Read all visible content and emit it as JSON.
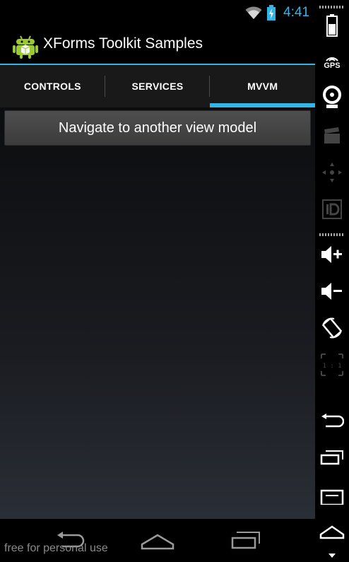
{
  "status_bar": {
    "time": "4:41",
    "icons": [
      "wifi-icon",
      "battery-charging-icon"
    ],
    "accent_color": "#33b5e5"
  },
  "action_bar": {
    "title": "XForms Toolkit Samples",
    "icon": "android-app-icon"
  },
  "tabs": [
    {
      "label": "CONTROLS",
      "selected": false
    },
    {
      "label": "SERVICES",
      "selected": false
    },
    {
      "label": "MVVM",
      "selected": true
    }
  ],
  "main": {
    "button_label": "Navigate to another view model"
  },
  "nav_bar": {
    "buttons": [
      "back-icon",
      "home-icon",
      "recent-apps-icon"
    ]
  },
  "watermark": "free for personal use",
  "emulator_toolbar": {
    "gps_label": "GPS",
    "scale_label": "1 : 1",
    "buttons": [
      "battery-icon",
      "gps-icon",
      "camera-icon",
      "clapperboard-icon",
      "dpad-icon",
      "id-icon",
      "volume-up-icon",
      "volume-down-icon",
      "rotate-icon",
      "scale-icon",
      "back-icon",
      "recent-apps-icon",
      "menu-icon",
      "home-icon"
    ]
  },
  "colors": {
    "accent": "#33b5e5",
    "tab_bar": "#191919",
    "button": "#464646"
  }
}
